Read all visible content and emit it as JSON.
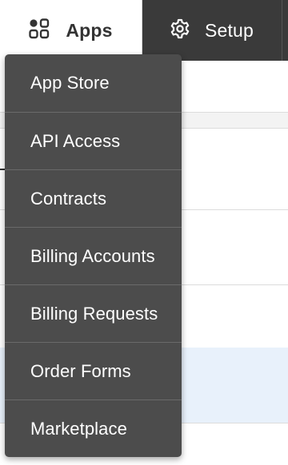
{
  "nav": {
    "tabs": [
      {
        "label": "Apps",
        "icon": "apps-grid-icon",
        "active": true
      },
      {
        "label": "Setup",
        "icon": "gear-icon",
        "active": false
      }
    ]
  },
  "apps_menu": {
    "items": [
      {
        "label": "App Store"
      },
      {
        "label": "API Access"
      },
      {
        "label": "Contracts"
      },
      {
        "label": "Billing Accounts"
      },
      {
        "label": "Billing Requests"
      },
      {
        "label": "Order Forms"
      },
      {
        "label": "Marketplace"
      }
    ]
  },
  "colors": {
    "topbar": "#3a3a3a",
    "menu_background": "#4c4c4c",
    "menu_divider": "#6a6a6a",
    "menu_text": "#ffffff",
    "active_tab": "#ffffff",
    "row_highlight": "#e8f1fb"
  }
}
